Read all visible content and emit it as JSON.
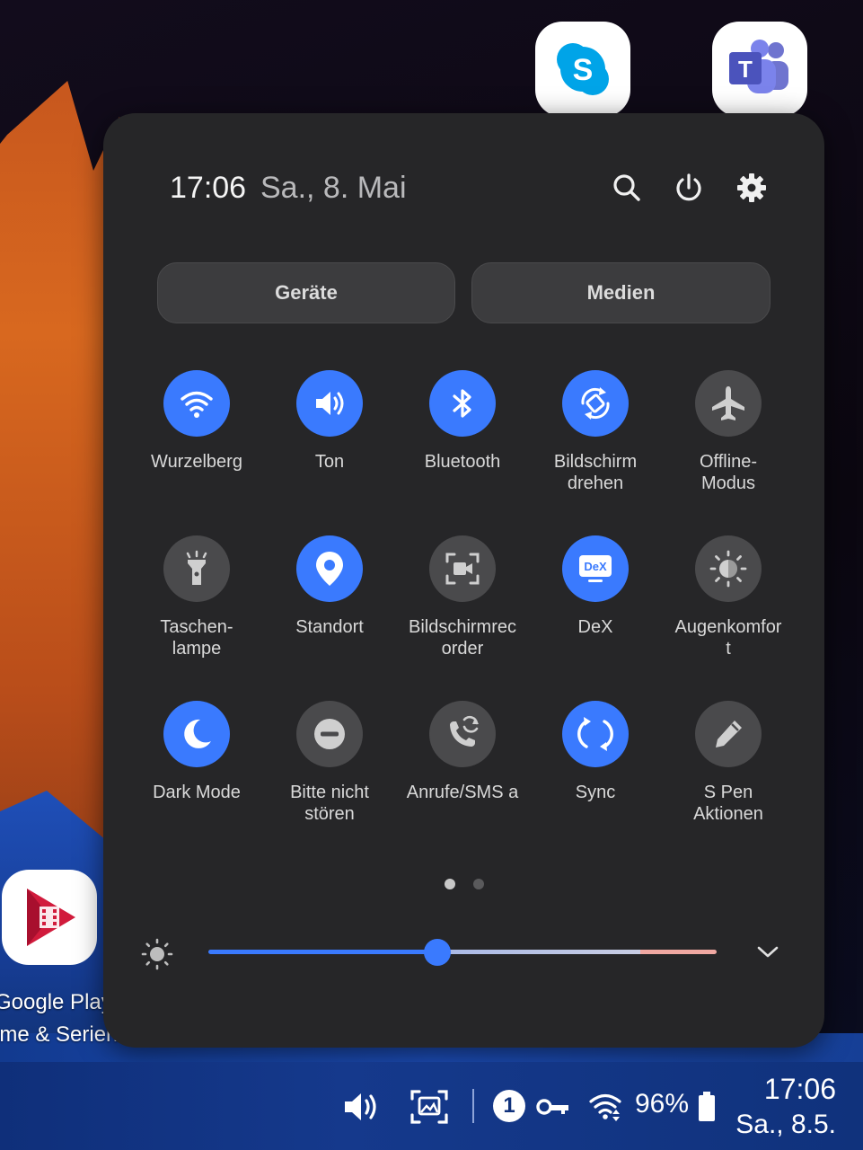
{
  "desktop": {
    "apps": [
      {
        "id": "skype"
      },
      {
        "id": "teams"
      },
      {
        "id": "google-play-movies",
        "label_line1": "Google Play",
        "label_line2": "lme & Serien"
      }
    ]
  },
  "quick_panel": {
    "header": {
      "time": "17:06",
      "date": "Sa., 8. Mai",
      "actions": [
        "search-icon",
        "power-icon",
        "settings-icon"
      ]
    },
    "pills": [
      {
        "label": "Geräte"
      },
      {
        "label": "Medien"
      }
    ],
    "tiles": [
      {
        "label": "Wurzelberg",
        "icon": "wifi-icon",
        "active": true
      },
      {
        "label": "Ton",
        "icon": "sound-icon",
        "active": true
      },
      {
        "label": "Bluetooth",
        "icon": "bluetooth-icon",
        "active": true
      },
      {
        "label": "Bildschirm\ndrehen",
        "icon": "auto-rotate-icon",
        "active": true
      },
      {
        "label": "Offline-\nModus",
        "icon": "airplane-icon",
        "active": false
      },
      {
        "label": "Taschen-\nlampe",
        "icon": "flashlight-icon",
        "active": false
      },
      {
        "label": "Standort",
        "icon": "location-icon",
        "active": true
      },
      {
        "label": "Bildschirmrec\norder",
        "icon": "screen-recorder-icon",
        "active": false
      },
      {
        "label": "DeX",
        "icon": "dex-icon",
        "active": true
      },
      {
        "label": "Augenkomfor\nt",
        "icon": "eye-comfort-icon",
        "active": false
      },
      {
        "label": "Dark Mode",
        "icon": "dark-mode-icon",
        "active": true
      },
      {
        "label": "Bitte nicht\nstören",
        "icon": "do-not-disturb-icon",
        "active": false
      },
      {
        "label": "Anrufe/SMS a",
        "icon": "call-sms-icon",
        "active": false
      },
      {
        "label": "Sync",
        "icon": "sync-icon",
        "active": true
      },
      {
        "label": "S Pen\nAktionen",
        "icon": "s-pen-icon",
        "active": false
      }
    ],
    "page_indicator": {
      "pages": 2,
      "current": 1
    },
    "brightness": {
      "level": 0.45
    }
  },
  "taskbar": {
    "notification_count": "1",
    "battery": "96%",
    "time": "17:06",
    "date": "Sa., 8.5."
  },
  "colors": {
    "accent": "#3a7afe",
    "panel_bg": "#262628",
    "tile_off": "#4a4a4c",
    "taskbar": "#15398c"
  }
}
